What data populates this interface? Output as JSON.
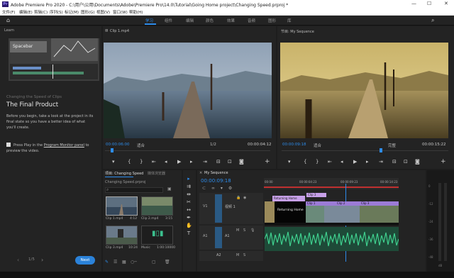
{
  "window": {
    "app_icon": "Pr",
    "title": "Adobe Premiere Pro 2020 - C:\\用户\\公用\\Documents\\Adobe\\Premiere Pro\\14.0\\Tutorial\\Going Home project\\Changing Speed.prproj *",
    "min": "—",
    "max": "☐",
    "close": "✕"
  },
  "menu": [
    "文件(F)",
    "编辑(E)",
    "剪辑(C)",
    "序列(S)",
    "标记(M)",
    "图形(G)",
    "视图(V)",
    "窗口(W)",
    "帮助(H)"
  ],
  "workspaces": [
    "学习",
    "组件",
    "编辑",
    "颜色",
    "效果",
    "音频",
    "图形",
    "库"
  ],
  "learn": {
    "header": "Learn",
    "thumb_label": "Spacebar",
    "subtitle": "Changing the Speed of Clips",
    "title": "The Final Product",
    "body": "Before you begin, take a look at the project in its final state so you have a better idea of what you'll create.",
    "check_text_1": "Press Play in the ",
    "check_link": "Program Monitor panel",
    "check_text_2": " to preview the video.",
    "pager": "1/5",
    "next": "Next"
  },
  "source": {
    "title": "Clip 1.mp4",
    "timecode": "00:00:06:00",
    "fit": "适合",
    "ratio": "1/2",
    "duration": "00:00:04:12"
  },
  "program": {
    "title": "节目: My Sequence",
    "timecode": "00:00:09:18",
    "fit": "适合",
    "quality": "完整",
    "duration": "00:00:15:22"
  },
  "project": {
    "tab1": "项目: Changing Speed",
    "tab2": "媒体浏览器",
    "path": "Changing Speed.prproj",
    "items": [
      {
        "name": "Clip 1.mp4",
        "dur": "4:12"
      },
      {
        "name": "Clip 2.mp4",
        "dur": "3:15"
      },
      {
        "name": "Clip 3.mp4",
        "dur": "10:24"
      },
      {
        "name": "Music",
        "dur": "1:00:10000"
      }
    ]
  },
  "timeline": {
    "tab": "My Sequence",
    "timecode": "00:00:09:18",
    "ticks": [
      "00:00",
      "00:00:04:23",
      "00:00:09:23",
      "00:00:14:23"
    ],
    "tracks": [
      {
        "id": "V1",
        "label": "视频 1"
      },
      {
        "id": "A1",
        "label": "A1"
      },
      {
        "id": "A2",
        "label": "A2"
      }
    ],
    "clips": {
      "title": "Returning Home",
      "fx1": "fx",
      "c1": "Clip 1",
      "c2": "Clip 2",
      "c3": "Clip 3"
    }
  },
  "meter_labels": [
    "0",
    "-12",
    "-24",
    "-36",
    "-48",
    "dB"
  ],
  "colors": {
    "accent": "#2d8ceb",
    "video_clip": "#9c7bd6",
    "audio_clip": "#2d6a4f",
    "playhead": "#2d8ceb"
  }
}
